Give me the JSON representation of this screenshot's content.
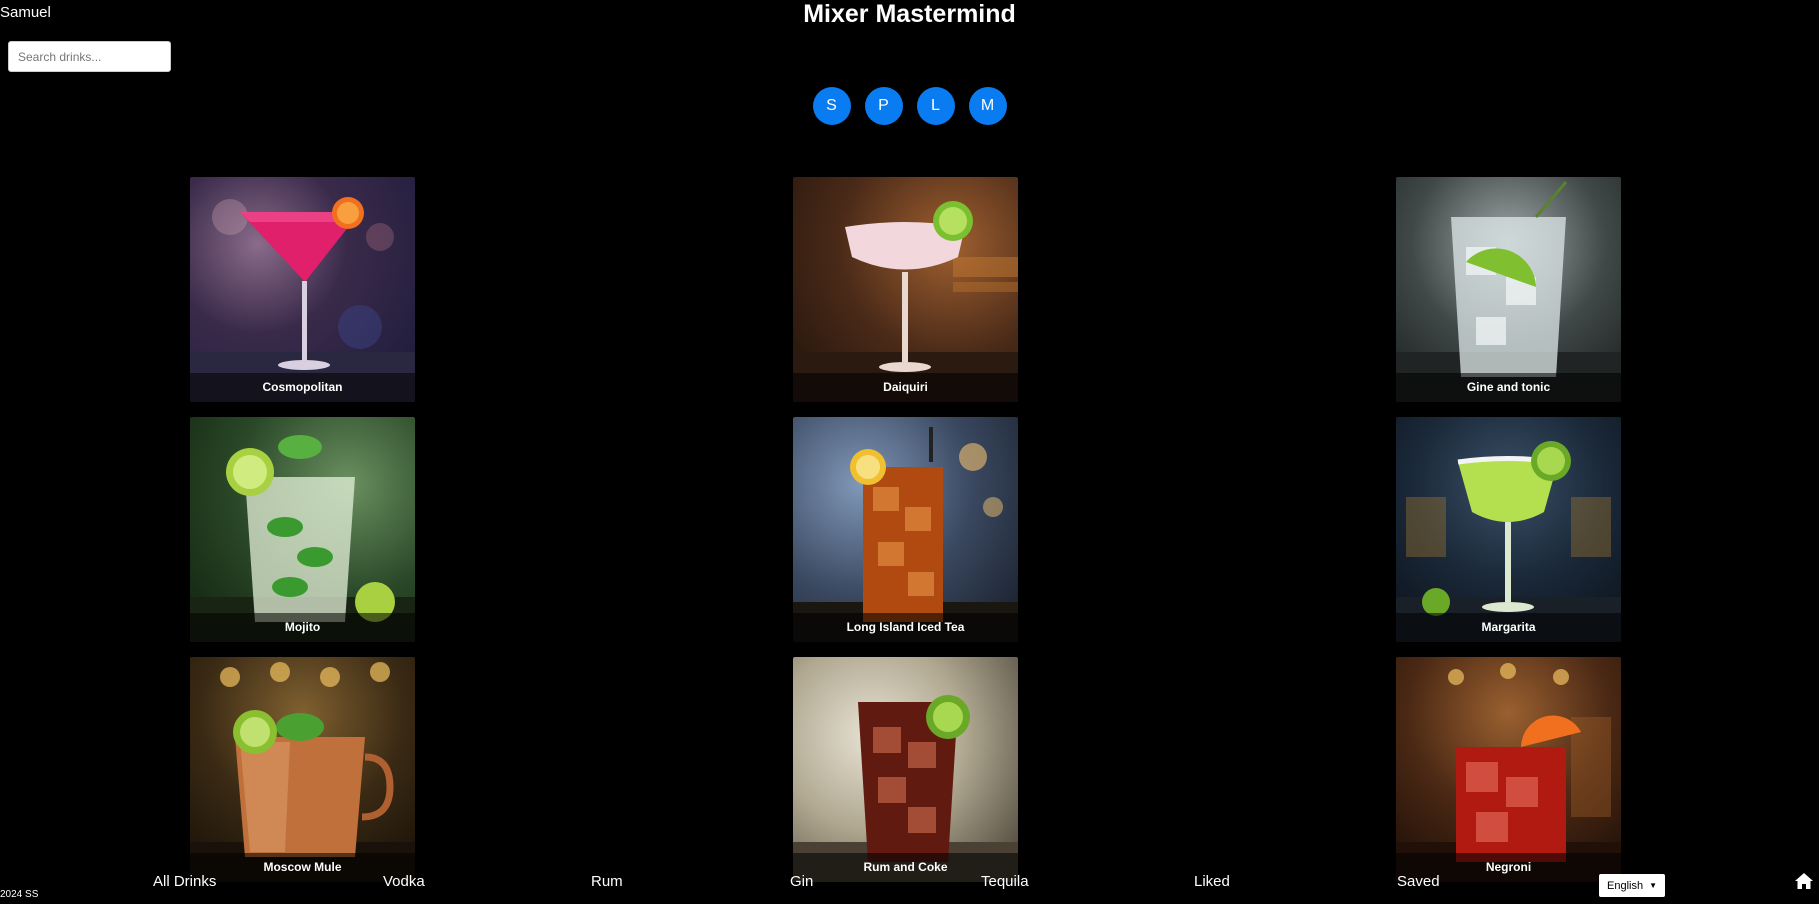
{
  "user": {
    "name": "Samuel"
  },
  "search": {
    "placeholder": "Search drinks..."
  },
  "header": {
    "title": "Mixer Mastermind"
  },
  "letter_filters": [
    "S",
    "P",
    "L",
    "M"
  ],
  "drinks": [
    {
      "name": "Cosmopolitan"
    },
    {
      "name": "Daiquiri"
    },
    {
      "name": "Gine and tonic"
    },
    {
      "name": "Mojito"
    },
    {
      "name": "Long Island Iced Tea"
    },
    {
      "name": "Margarita"
    },
    {
      "name": "Moscow Mule"
    },
    {
      "name": "Rum and Coke"
    },
    {
      "name": "Negroni"
    }
  ],
  "bottom_nav": {
    "all": "All Drinks",
    "vodka": "Vodka",
    "rum": "Rum",
    "gin": "Gin",
    "tequila": "Tequila",
    "liked": "Liked",
    "saved": "Saved"
  },
  "language": {
    "selected": "English"
  },
  "footer": {
    "copyright": "2024 SS"
  },
  "colors": {
    "accent": "#0a7cf2",
    "background": "#000000"
  },
  "icons": {
    "home": "home-icon",
    "caret": "caret-down-icon"
  }
}
